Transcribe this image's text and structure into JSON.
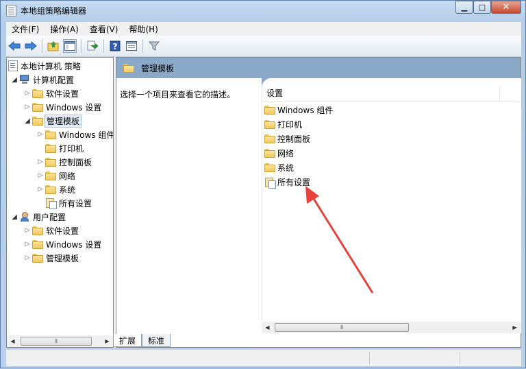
{
  "window": {
    "title": "本地组策略编辑器"
  },
  "menu": [
    "文件(F)",
    "操作(A)",
    "查看(V)",
    "帮助(H)"
  ],
  "toolbar": {
    "icons": [
      "back-arrow-icon",
      "forward-arrow-icon",
      "up-folder-icon",
      "show-hide-tree-icon",
      "export-list-icon",
      "help-icon",
      "properties-view-icon",
      "filter-icon"
    ]
  },
  "tree": {
    "root": "本地计算机 策略",
    "computer_config": "计算机配置",
    "software_settings_1": "软件设置",
    "windows_settings_1": "Windows 设置",
    "admin_templates_1": "管理模板",
    "windows_components": "Windows 组件",
    "printers": "打印机",
    "control_panel": "控制面板",
    "network": "网络",
    "system": "系统",
    "all_settings": "所有设置",
    "user_config": "用户配置",
    "software_settings_2": "软件设置",
    "windows_settings_2": "Windows 设置",
    "admin_templates_2": "管理模板"
  },
  "right": {
    "header_title": "管理模板",
    "description": "选择一个项目来查看它的描述。",
    "column_header": "设置",
    "items": [
      "Windows 组件",
      "打印机",
      "控制面板",
      "网络",
      "系统",
      "所有设置"
    ]
  },
  "tabs": [
    "扩展",
    "标准"
  ],
  "annotation": {
    "color": "#e8403a",
    "points_to": "所有设置"
  }
}
